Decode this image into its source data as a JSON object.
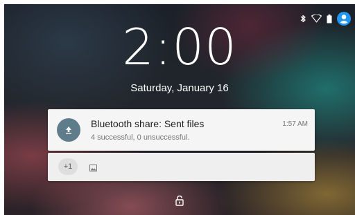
{
  "lockscreen": {
    "time": "2:00",
    "date": "Saturday, January 16"
  },
  "status_bar": {
    "icons": [
      "bluetooth-icon",
      "wifi-icon",
      "battery-icon",
      "user-icon"
    ]
  },
  "notification": {
    "icon": "upload-icon",
    "title": "Bluetooth share: Sent files",
    "text": "4 successful, 0 unsuccessful.",
    "time": "1:57 AM"
  },
  "overflow": {
    "count_label": "+1",
    "icon": "image-icon"
  },
  "unlock": {
    "icon": "lock-icon"
  },
  "colors": {
    "avatar": "#2196f3",
    "notification_icon_bg": "#5f7c8a"
  }
}
